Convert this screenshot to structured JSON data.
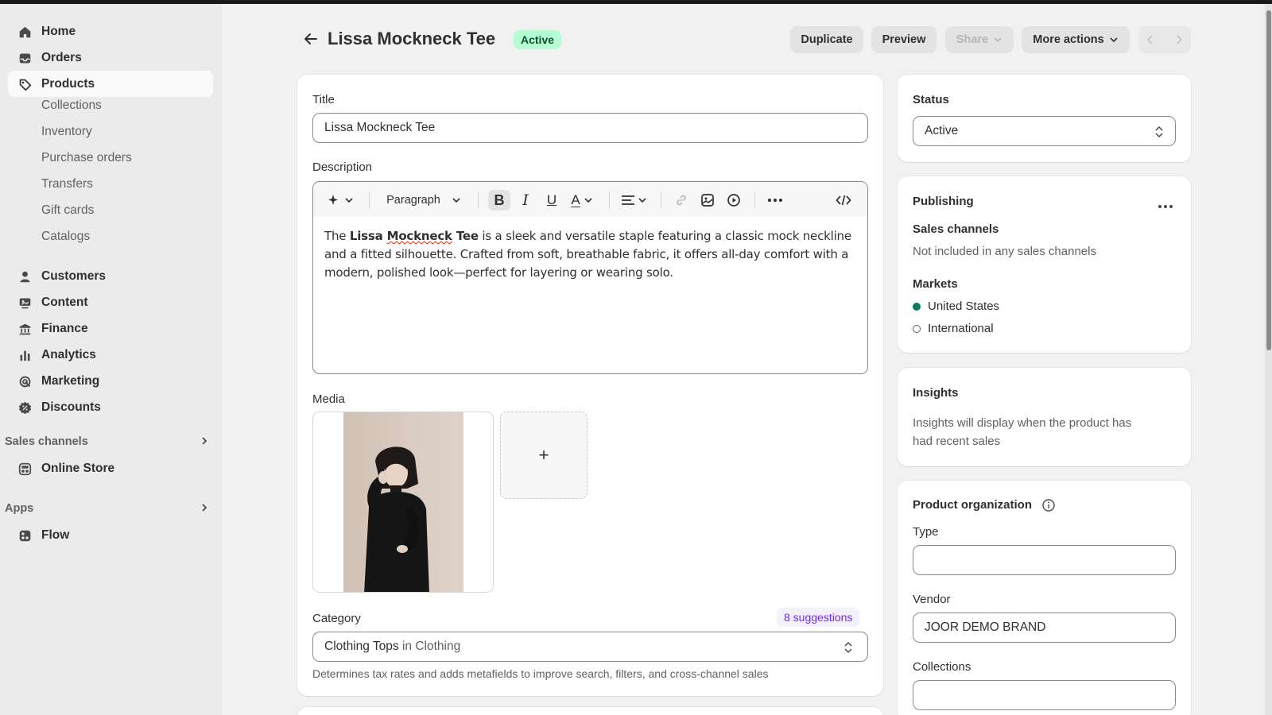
{
  "sidebar": {
    "main_items": [
      {
        "label": "Home"
      },
      {
        "label": "Orders"
      },
      {
        "label": "Products"
      }
    ],
    "product_sub_items": [
      "Collections",
      "Inventory",
      "Purchase orders",
      "Transfers",
      "Gift cards",
      "Catalogs"
    ],
    "other_items": [
      {
        "label": "Customers"
      },
      {
        "label": "Content"
      },
      {
        "label": "Finance"
      },
      {
        "label": "Analytics"
      },
      {
        "label": "Marketing"
      },
      {
        "label": "Discounts"
      }
    ],
    "sales_channels_heading": "Sales channels",
    "sales_channels_item": "Online Store",
    "apps_heading": "Apps",
    "apps_item": "Flow"
  },
  "header": {
    "title": "Lissa Mockneck Tee",
    "status_badge": "Active",
    "buttons": {
      "duplicate": "Duplicate",
      "preview": "Preview",
      "share": "Share",
      "more_actions": "More actions"
    }
  },
  "main": {
    "title_label": "Title",
    "title_value": "Lissa Mockneck Tee",
    "description_label": "Description",
    "toolbar_format": "Paragraph",
    "description": {
      "pre": "The ",
      "bold_1": "Lissa",
      "space": " ",
      "bold_2": "Mockneck",
      "bold_3": " Tee",
      "post": " is a sleek and versatile staple featuring a classic mock neckline and a fitted silhouette. Crafted from soft, breathable fabric, it offers all-day comfort with a modern, polished look—perfect for layering or wearing solo."
    },
    "media_label": "Media",
    "media_add": "+",
    "category_label": "Category",
    "category_suggestions": "8 suggestions",
    "category_value": "Clothing Tops",
    "category_context": "in Clothing",
    "category_help": "Determines tax rates and adds metafields to improve search, filters, and cross-channel sales"
  },
  "right": {
    "status_heading": "Status",
    "status_value": "Active",
    "publishing_heading": "Publishing",
    "sales_channels_heading": "Sales channels",
    "sales_channels_text": "Not included in any sales channels",
    "markets_heading": "Markets",
    "markets": [
      {
        "label": "United States",
        "active": true
      },
      {
        "label": "International",
        "active": false
      }
    ],
    "insights_heading": "Insights",
    "insights_text_1": "Insights will display when the product has",
    "insights_text_2": "had recent sales",
    "org_heading": "Product organization",
    "type_label": "Type",
    "type_value": "",
    "vendor_label": "Vendor",
    "vendor_value": "JOOR DEMO BRAND",
    "collections_label": "Collections",
    "collections_value": ""
  },
  "colors": {
    "badge_bg": "#b4fed2",
    "badge_text": "#0c5132",
    "market_active": "#047b5d",
    "suggestion": "#7126ff"
  }
}
